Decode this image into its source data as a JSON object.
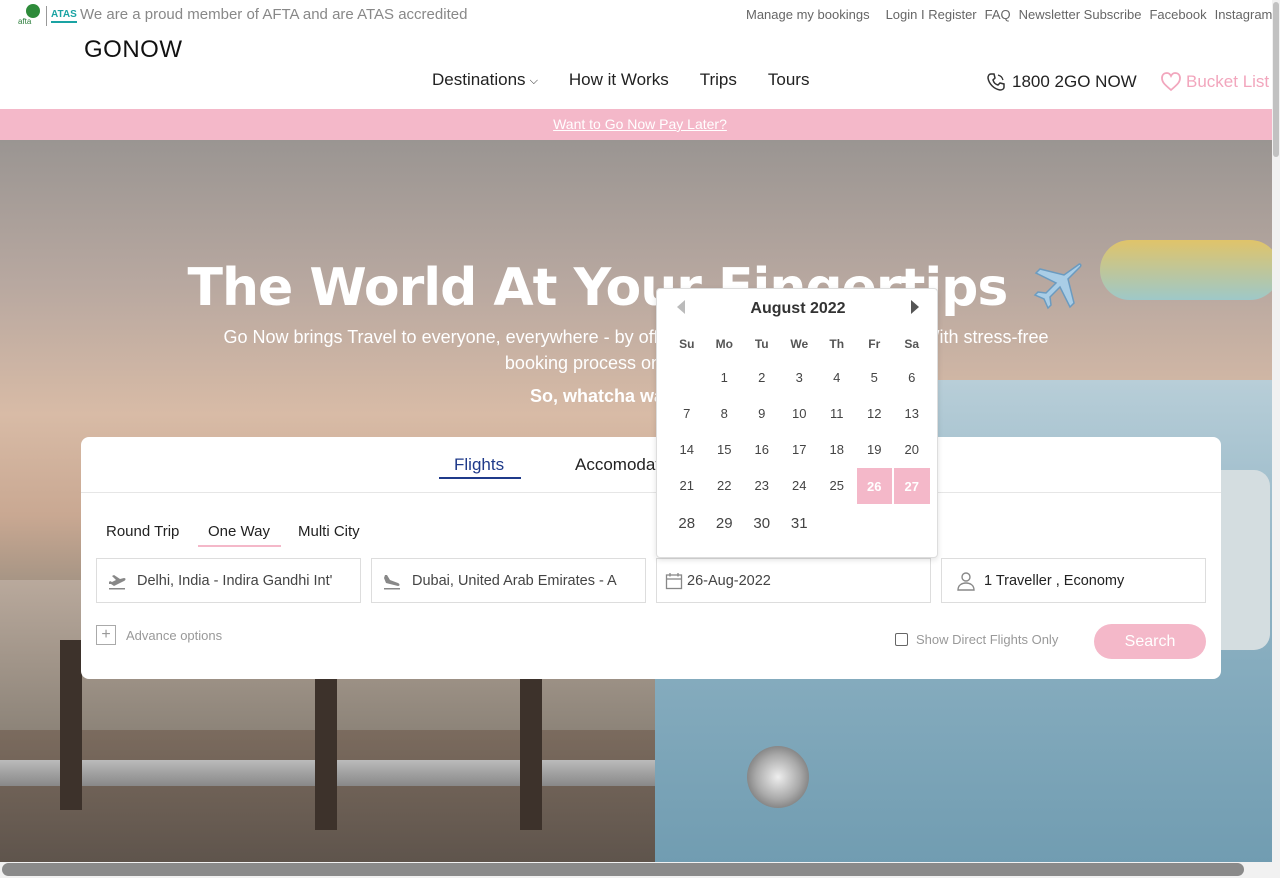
{
  "topbar": {
    "afta_logo": "afta",
    "atas_logo": "ATAS",
    "member_text": "We are a proud member of AFTA and are ATAS accredited",
    "links": [
      "Manage my bookings",
      "Login I Register",
      "FAQ",
      "Newsletter Subscribe",
      "Facebook",
      "Instagram"
    ]
  },
  "nav": {
    "brand": "GONOW",
    "menu": [
      "Destinations",
      "How it Works",
      "Trips",
      "Tours"
    ],
    "phone": "1800 2GO NOW",
    "bucket": "Bucket List"
  },
  "banner": {
    "text": "Want to Go Now Pay Later?"
  },
  "hero": {
    "title": "The World At Your Fingertips",
    "subtitle": "Go Now brings Travel to everyone, everywhere - by offering flexible payment Solutions. With stress-free booking process on our platform.",
    "subtitle2": "So, whatcha waiting for?"
  },
  "search": {
    "tabs": [
      "Flights",
      "Accomodation"
    ],
    "trip_types": [
      "Round Trip",
      "One Way",
      "Multi City"
    ],
    "from": "Delhi, India - Indira Gandhi Int'",
    "to": "Dubai, United Arab Emirates - A",
    "date": "26-Aug-2022",
    "travellers": "1 Traveller , Economy",
    "advance_options": "Advance options",
    "direct_only": "Show Direct Flights Only",
    "search_button": "Search"
  },
  "datepicker": {
    "title": "August 2022",
    "weekdays": [
      "Su",
      "Mo",
      "Tu",
      "We",
      "Th",
      "Fr",
      "Sa"
    ],
    "weeks": [
      [
        "",
        "1",
        "2",
        "3",
        "4",
        "5",
        "6"
      ],
      [
        "7",
        "8",
        "9",
        "10",
        "11",
        "12",
        "13"
      ],
      [
        "14",
        "15",
        "16",
        "17",
        "18",
        "19",
        "20"
      ],
      [
        "21",
        "22",
        "23",
        "24",
        "25",
        "26",
        "27"
      ],
      [
        "28",
        "29",
        "30",
        "31",
        "",
        "",
        ""
      ]
    ],
    "selected": [
      "26",
      "27"
    ]
  },
  "colors": {
    "accent_pink": "#f4b8c9",
    "accent_blue": "#1f3a8a"
  },
  "icons": [
    "plane-icon",
    "phone-icon",
    "heart-icon",
    "takeoff-icon",
    "landing-icon",
    "calendar-icon",
    "user-icon",
    "chevron-down-icon"
  ]
}
